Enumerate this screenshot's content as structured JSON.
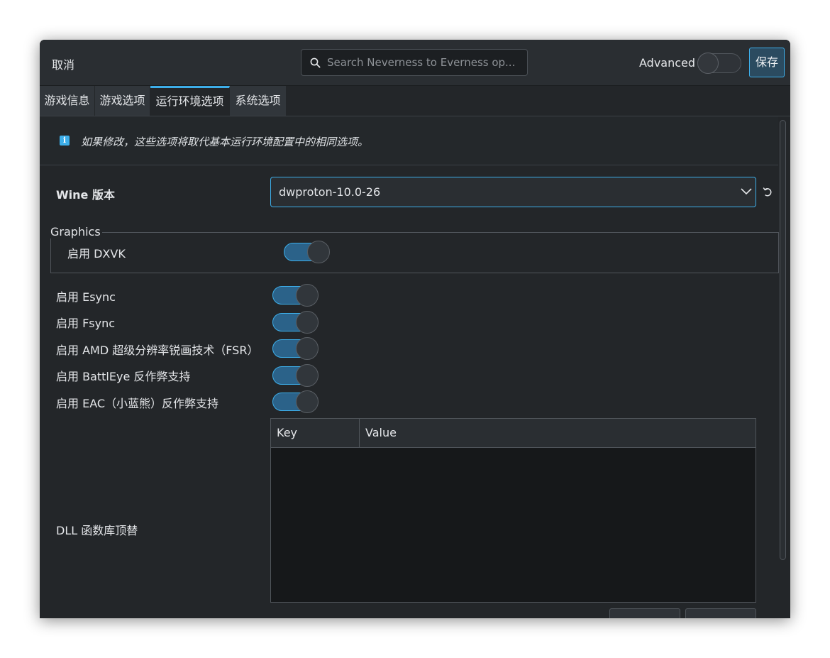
{
  "titlebar": {
    "cancel_label": "取消",
    "search_placeholder": "Search Neverness to Everness op...",
    "advanced_label": "Advanced",
    "advanced_on": false,
    "save_label": "保存"
  },
  "tabs": [
    {
      "label": "游戏信息",
      "active": false
    },
    {
      "label": "游戏选项",
      "active": false
    },
    {
      "label": "运行环境选项",
      "active": true
    },
    {
      "label": "系统选项",
      "active": false
    }
  ],
  "info": {
    "text": "如果修改，这些选项将取代基本运行环境配置中的相同选项。"
  },
  "wine": {
    "label": "Wine 版本",
    "value": "dwproton-10.0-26"
  },
  "graphics": {
    "legend": "Graphics",
    "dxvk_label": "启用 DXVK",
    "dxvk_on": true
  },
  "options": [
    {
      "label": "启用 Esync",
      "on": true
    },
    {
      "label": "启用 Fsync",
      "on": true
    },
    {
      "label": "启用 AMD 超级分辨率锐画技术（FSR）",
      "on": true
    },
    {
      "label": "启用 BattlEye 反作弊支持",
      "on": true
    },
    {
      "label": "启用 EAC（小蓝熊）反作弊支持",
      "on": true
    }
  ],
  "dll": {
    "label": "DLL 函数库顶替",
    "columns": [
      "Key",
      "Value"
    ],
    "rows": []
  },
  "colors": {
    "accent": "#3daee9",
    "background": "#232629",
    "toggle_fill": "#2b6289"
  }
}
